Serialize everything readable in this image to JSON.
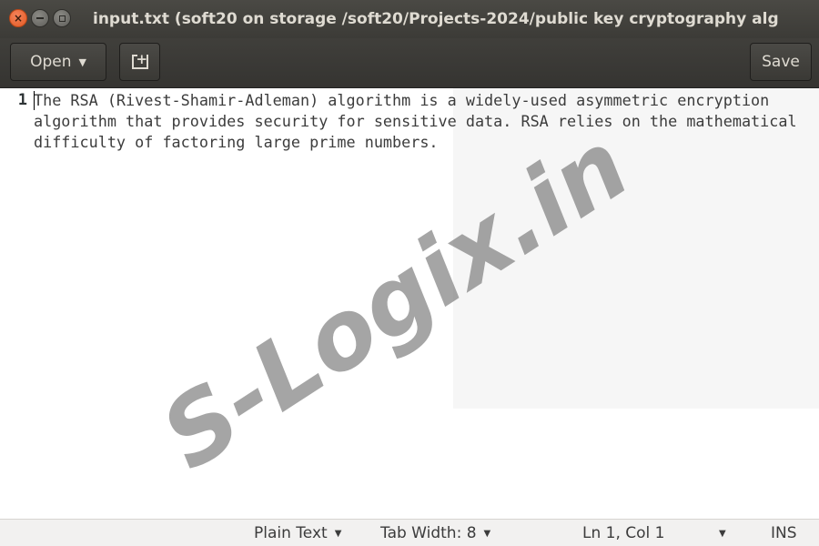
{
  "window": {
    "title": "input.txt (soft20 on storage /soft20/Projects-2024/public key cryptography alg",
    "controls": {
      "close_glyph": "×"
    }
  },
  "header": {
    "open_label": "Open",
    "open_caret": "▼",
    "save_label": "Save",
    "new_document_icon": "new-document-icon"
  },
  "editor": {
    "line_number": "1",
    "text": "The RSA (Rivest-Shamir-Adleman) algorithm is a widely-used asymmetric encryption algorithm that provides security for sensitive data. RSA relies on the mathematical difficulty of factoring large prime numbers."
  },
  "watermark": {
    "text": "S-Logix.in"
  },
  "statusbar": {
    "language": "Plain Text",
    "tab_width": "Tab Width: 8",
    "position": "Ln 1, Col 1",
    "mode": "INS",
    "caret": "▼"
  },
  "colors": {
    "titlebar_bg": "#3c3b37",
    "close_button": "#e15a23",
    "editor_bg": "#ffffff",
    "statusbar_bg": "#f2f1f0",
    "watermark": "#6e6e6e"
  }
}
